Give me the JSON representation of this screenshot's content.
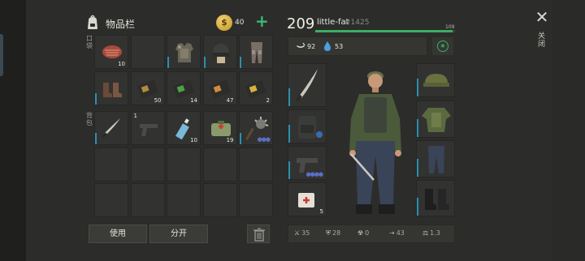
{
  "inventory": {
    "title": "物品栏",
    "pocket_label": "口袋",
    "backpack_label": "背包",
    "coins": "40",
    "add_coins": "+",
    "top_slots": [
      {
        "item": "raw-meat",
        "qty": "10"
      },
      {
        "item": "empty",
        "qty": ""
      },
      {
        "item": "body-armor",
        "qty": ""
      },
      {
        "item": "combat-helmet",
        "qty": ""
      },
      {
        "item": "armored-leggings",
        "qty": ""
      },
      {
        "item": "leather-boots",
        "qty": ""
      },
      {
        "item": "blueprint-pack",
        "qty": "50"
      },
      {
        "item": "blueprint-pack-green",
        "qty": "14"
      },
      {
        "item": "blueprint-pack-orange",
        "qty": "47"
      },
      {
        "item": "blueprint-pack-blue",
        "qty": "2"
      }
    ],
    "backpack_slots": [
      {
        "item": "machete",
        "qty": ""
      },
      {
        "item": "pistol",
        "qty": "1"
      },
      {
        "item": "water-bottle",
        "qty": "10"
      },
      {
        "item": "first-aid-kit",
        "qty": "19"
      },
      {
        "item": "spiked-mace",
        "qty": ""
      }
    ],
    "use_button": "使用",
    "split_button": "分开"
  },
  "character": {
    "level": "209",
    "name": "little-fat",
    "id": "#1425",
    "xp_max": "109",
    "xp_progress": 0.98,
    "food": "92",
    "water": "53",
    "bandage_qty": "5",
    "stats": {
      "attack": "35",
      "defense": "28",
      "radiation": "0",
      "speed": "43",
      "weight": "1.3"
    }
  },
  "window": {
    "close_label": "关闭"
  },
  "colors": {
    "accent_green": "#3cae63",
    "rarity_blue": "#2e8fb0",
    "coin_gold": "#d9a62a"
  }
}
